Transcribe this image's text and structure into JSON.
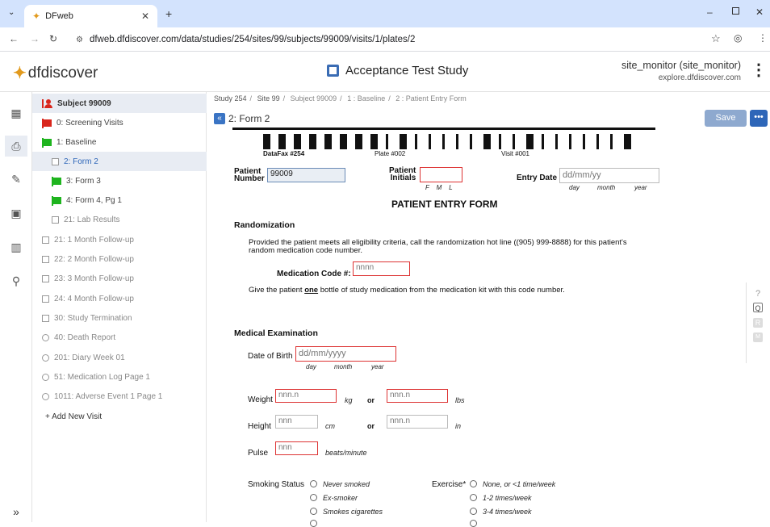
{
  "browser": {
    "tab_title": "DFweb",
    "url": "dfweb.dfdiscover.com/data/studies/254/sites/99/subjects/99009/visits/1/plates/2"
  },
  "header": {
    "logo": "dfdiscover",
    "study_title": "Acceptance Test Study",
    "user_name": "site_monitor (site_monitor)",
    "user_host": "explore.dfdiscover.com"
  },
  "visits": {
    "subject": "Subject 99009",
    "items": [
      {
        "label": "0: Screening Visits"
      },
      {
        "label": "1: Baseline"
      },
      {
        "label": "2: Form 2"
      },
      {
        "label": "3: Form 3"
      },
      {
        "label": "4: Form 4, Pg 1"
      },
      {
        "label": "21: Lab Results"
      },
      {
        "label": "21: 1 Month Follow-up"
      },
      {
        "label": "22: 2 Month Follow-up"
      },
      {
        "label": "23: 3 Month Follow-up"
      },
      {
        "label": "24: 4 Month Follow-up"
      },
      {
        "label": "30: Study Termination"
      },
      {
        "label": "40: Death Report"
      },
      {
        "label": "201: Diary Week 01"
      },
      {
        "label": "51: Medication Log Page 1"
      },
      {
        "label": "1011: Adverse Event 1 Page 1"
      }
    ],
    "add_visit": "+ Add New Visit"
  },
  "breadcrumb": [
    "Study 254",
    "Site 99",
    "Subject 99009",
    "1 : Baseline",
    "2 : Patient Entry Form"
  ],
  "form": {
    "name": "2: Form 2",
    "save": "Save",
    "more": "•••",
    "datafax": "DataFax #254",
    "plate": "Plate #002",
    "visit": "Visit #001",
    "patient_number_label_1": "Patient",
    "patient_number_label_2": "Number",
    "patient_number": "99009",
    "patient_initials_label_1": "Patient",
    "patient_initials_label_2": "Initials",
    "initials_hint": "F    M    L",
    "entry_date_label": "Entry Date",
    "entry_date_placeholder": "dd/mm/yy",
    "day": "day",
    "month": "month",
    "year": "year",
    "title": "PATIENT ENTRY FORM",
    "randomization": "Randomization",
    "rand_text": "Provided the patient meets all eligibility criteria, call the randomization hot line ((905) 999-8888) for this patient's random medication code number.",
    "med_code_label": "Medication Code #:",
    "med_code_placeholder": "nnnn",
    "give_1": "Give the patient ",
    "give_one": "one",
    "give_2": " bottle of study medication from the medication kit with this code number.",
    "medical_exam": "Medical Examination",
    "dob_label": "Date of Birth",
    "dob_placeholder": "dd/mm/yyyy",
    "weight_label": "Weight",
    "weight_ph": "nnn.n",
    "kg": "kg",
    "or": "or",
    "lbs": "lbs",
    "height_label": "Height",
    "height_ph": "nnn",
    "height_in_ph": "nnn.n",
    "cm": "cm",
    "in": "in",
    "pulse_label": "Pulse",
    "pulse_ph": "nnn",
    "beats": "beats/minute",
    "smoking_label": "Smoking Status",
    "smoking_opts": [
      "Never smoked",
      "Ex-smoker",
      "Smokes cigarettes"
    ],
    "exercise_label": "Exercise*",
    "exercise_opts": [
      "None, or <1 time/week",
      "1-2 times/week",
      "3-4 times/week"
    ]
  },
  "colors": {
    "accent": "#2e66b8",
    "flag_red": "#d9261c",
    "flag_green": "#1eb41e",
    "field_red": "#d33"
  }
}
